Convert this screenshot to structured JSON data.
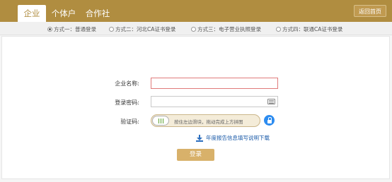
{
  "tabs": [
    {
      "label": "企业",
      "active": true
    },
    {
      "label": "个体户",
      "active": false
    },
    {
      "label": "合作社",
      "active": false
    }
  ],
  "home_button": "返回首页",
  "methods": [
    {
      "label": "方式一：普通登录",
      "selected": true
    },
    {
      "label": "方式二：河北CA证书登录",
      "selected": false
    },
    {
      "label": "方式三：电子营业执照登录",
      "selected": false
    },
    {
      "label": "方式四：联通CA证书登录",
      "selected": false
    }
  ],
  "form": {
    "company_label": "企业名称:",
    "company_value": "",
    "password_label": "登录密码:",
    "password_value": "",
    "verify_label": "验证码:",
    "slider_text": "按住左边滑块，拖动完成上方拼图"
  },
  "download_text": "年度报告信息填写说明下载",
  "login_button": "登录",
  "colors": {
    "brand": "#b08d40",
    "button": "#d8b16a",
    "link": "#1a5aa8",
    "error_border": "#e07b7b"
  }
}
